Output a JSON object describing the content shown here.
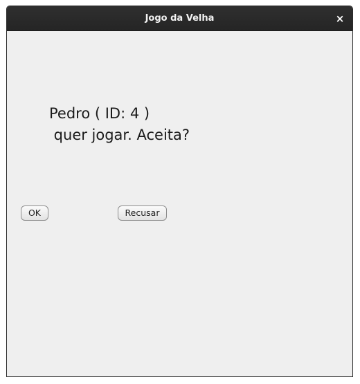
{
  "window": {
    "title": "Jogo da Velha",
    "close_glyph": "×"
  },
  "dialog": {
    "line1": "Pedro ( ID: 4 )",
    "line2": " quer jogar. Aceita?",
    "ok_label": "OK",
    "refuse_label": "Recusar"
  }
}
